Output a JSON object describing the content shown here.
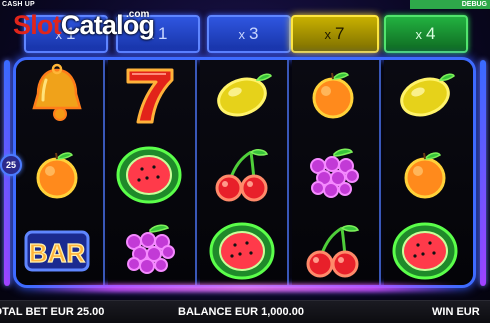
{
  "header": {
    "game_title": "CASH UP",
    "debug_badge": "DEBUG"
  },
  "watermark": {
    "part1": "Slot",
    "part2": "Catalog",
    "suffix": ".com"
  },
  "multipliers": [
    {
      "prefix": "x",
      "value": "1",
      "color": "blue"
    },
    {
      "prefix": "x",
      "value": "1",
      "color": "blue"
    },
    {
      "prefix": "x",
      "value": "3",
      "color": "blue"
    },
    {
      "prefix": "x",
      "value": "7",
      "color": "yellow"
    },
    {
      "prefix": "x",
      "value": "4",
      "color": "green"
    }
  ],
  "lines_badge": "25",
  "reels": [
    [
      "bell-icon",
      "orange-icon",
      "bar-icon"
    ],
    [
      "seven-icon",
      "watermelon-icon",
      "grapes-icon"
    ],
    [
      "lemon-icon",
      "cherries-icon",
      "watermelon-icon"
    ],
    [
      "orange-icon",
      "grapes-icon",
      "cherries-icon"
    ],
    [
      "lemon-icon",
      "orange-icon",
      "watermelon-icon"
    ]
  ],
  "bar_symbol_text": "BAR",
  "footer": {
    "total_bet_label": "TOTAL BET EUR",
    "total_bet_value": "25.00",
    "balance_label": "BALANCE EUR",
    "balance_value": "1,000.00",
    "win_label": "WIN EUR"
  },
  "colors": {
    "frame": "#3e6bff",
    "multiplier_blue": "#1f44c8",
    "multiplier_yellow": "#c8b000",
    "multiplier_green": "#22b140",
    "watermark_red": "#e0251b"
  }
}
